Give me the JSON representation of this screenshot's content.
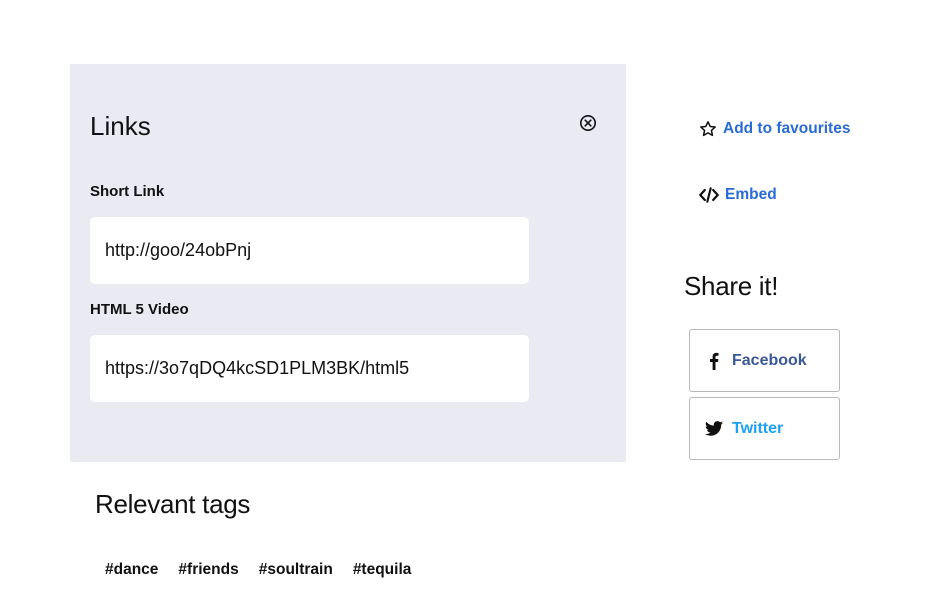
{
  "links_panel": {
    "title": "Links",
    "short_link_label": "Short Link",
    "short_link_value": "http://goo/24obPnj",
    "html5_label": "HTML 5 Video",
    "html5_value": "https://3o7qDQ4kcSD1PLM3BK/html5",
    "background": "#e9eaf2"
  },
  "actions": {
    "favourites_label": "Add to favourites",
    "embed_label": "Embed",
    "link_color": "#2a6bd6"
  },
  "share": {
    "title": "Share it!",
    "facebook_label": "Facebook",
    "twitter_label": "Twitter",
    "facebook_color": "#3b5998",
    "twitter_color": "#1da1f2"
  },
  "tags": {
    "title": "Relevant tags",
    "items": [
      "#dance",
      "#friends",
      "#soultrain",
      "#tequila"
    ]
  },
  "icons": [
    "close-circle-icon",
    "star-outline-icon",
    "code-icon",
    "facebook-icon",
    "twitter-icon"
  ]
}
